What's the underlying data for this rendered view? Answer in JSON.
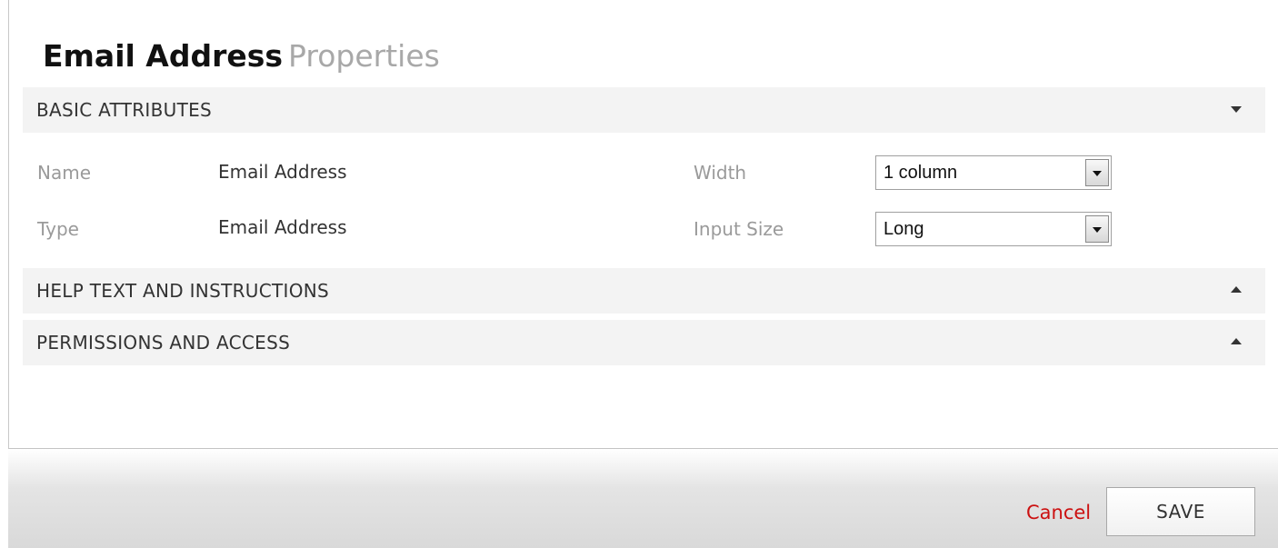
{
  "title": {
    "main": "Email Address",
    "sub": "Properties"
  },
  "sections": {
    "basic": {
      "label": "BASIC ATTRIBUTES",
      "state": "expanded"
    },
    "help": {
      "label": "HELP TEXT AND INSTRUCTIONS",
      "state": "collapsed"
    },
    "permissions": {
      "label": "PERMISSIONS AND ACCESS",
      "state": "collapsed"
    }
  },
  "basic_attributes": {
    "name": {
      "label": "Name",
      "value": "Email Address"
    },
    "type": {
      "label": "Type",
      "value": "Email Address"
    },
    "width": {
      "label": "Width",
      "selected": "1 column"
    },
    "input_size": {
      "label": "Input Size",
      "selected": "Long"
    }
  },
  "footer": {
    "cancel_label": "Cancel",
    "save_label": "SAVE"
  },
  "icons": {
    "expanded": "caret-down-icon",
    "collapsed": "caret-up-icon",
    "dropdown": "dropdown-arrow-icon"
  },
  "colors": {
    "cancel": "#cc1111",
    "section_bg": "#f3f3f3",
    "label_gray": "#9a9a9a"
  }
}
